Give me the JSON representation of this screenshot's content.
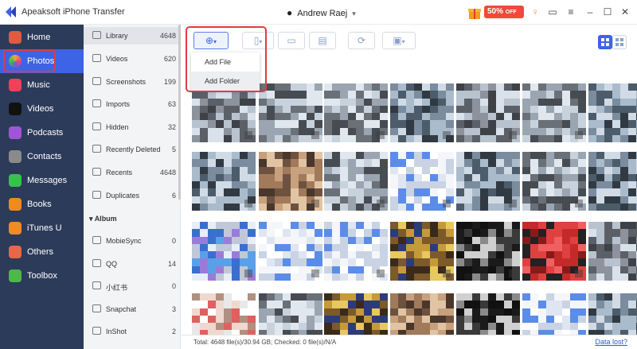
{
  "window": {
    "title": "Apeaksoft iPhone Transfer",
    "device_name": "Andrew Raej",
    "promo": {
      "percent": "50%",
      "suffix": "OFF"
    }
  },
  "nav": {
    "items": [
      {
        "label": "Home",
        "icon": "home-icon",
        "color": "#e05b3f"
      },
      {
        "label": "Photos",
        "icon": "photos-icon",
        "color": "#f2a23c"
      },
      {
        "label": "Music",
        "icon": "music-icon",
        "color": "#f0405a"
      },
      {
        "label": "Videos",
        "icon": "tv-icon",
        "color": "#111111"
      },
      {
        "label": "Podcasts",
        "icon": "podcasts-icon",
        "color": "#a254d8"
      },
      {
        "label": "Contacts",
        "icon": "contacts-icon",
        "color": "#8a8a8a"
      },
      {
        "label": "Messages",
        "icon": "messages-icon",
        "color": "#36c24b"
      },
      {
        "label": "Books",
        "icon": "books-icon",
        "color": "#ef8a1f"
      },
      {
        "label": "iTunes U",
        "icon": "itunes-u-icon",
        "color": "#f08a24"
      },
      {
        "label": "Others",
        "icon": "others-icon",
        "color": "#e8664a"
      },
      {
        "label": "Toolbox",
        "icon": "toolbox-icon",
        "color": "#4cb84a"
      }
    ],
    "active_index": 1
  },
  "sidebar": {
    "items": [
      {
        "label": "Library",
        "count": "4648"
      },
      {
        "label": "Videos",
        "count": "620"
      },
      {
        "label": "Screenshots",
        "count": "199"
      },
      {
        "label": "Imports",
        "count": "63"
      },
      {
        "label": "Hidden",
        "count": "32"
      },
      {
        "label": "Recently Deleted",
        "count": "5"
      },
      {
        "label": "Recents",
        "count": "4648"
      },
      {
        "label": "Duplicates",
        "count": "6"
      }
    ],
    "album_header": "Album",
    "albums": [
      {
        "label": "MobieSync",
        "count": "0"
      },
      {
        "label": "QQ",
        "count": "14"
      },
      {
        "label": "小红书",
        "count": "0"
      },
      {
        "label": "Snapchat",
        "count": "3"
      },
      {
        "label": "InShot",
        "count": "2"
      }
    ]
  },
  "toolbar": {
    "add_menu": [
      "Add File",
      "Add Folder"
    ]
  },
  "status": {
    "text": "Total: 4648 file(s)/30.94 GB; Checked: 0 file(s)/N/A",
    "data_lost": "Data lost?"
  },
  "colors": {
    "nav_bg": "#2d3b5a",
    "nav_active": "#3d63e6",
    "highlight_red": "#e23b3b",
    "link_blue": "#2a5ad7"
  }
}
